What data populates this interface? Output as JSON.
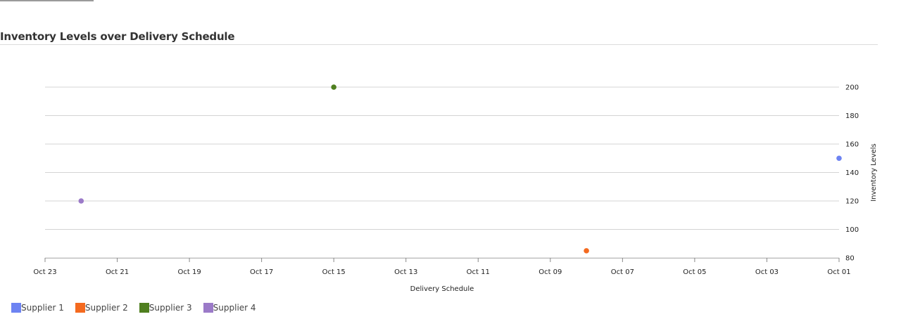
{
  "chart_data": {
    "type": "scatter",
    "title": "Inventory Levels over Delivery Schedule",
    "xlabel": "Delivery Schedule",
    "ylabel": "Inventory Levels",
    "x_axis": {
      "kind": "date",
      "reversed": true,
      "range": [
        "Oct 01",
        "Oct 23"
      ],
      "ticks": [
        "Oct 23",
        "Oct 21",
        "Oct 19",
        "Oct 17",
        "Oct 15",
        "Oct 13",
        "Oct 11",
        "Oct 09",
        "Oct 07",
        "Oct 05",
        "Oct 03",
        "Oct 01"
      ]
    },
    "y_axis": {
      "position": "right",
      "ylim": [
        80,
        200
      ],
      "ticks": [
        80,
        100,
        120,
        140,
        160,
        180,
        200
      ]
    },
    "grid": "horizontal",
    "legend_position": "bottom-left",
    "series": [
      {
        "name": "Supplier 1",
        "color": "#6d83f2",
        "points": [
          {
            "x": "Oct 01",
            "y": 150
          }
        ]
      },
      {
        "name": "Supplier 2",
        "color": "#f46a1f",
        "points": [
          {
            "x": "Oct 08",
            "y": 85
          }
        ]
      },
      {
        "name": "Supplier 3",
        "color": "#4f7f1f",
        "points": [
          {
            "x": "Oct 15",
            "y": 200
          }
        ]
      },
      {
        "name": "Supplier 4",
        "color": "#9b7ac8",
        "points": [
          {
            "x": "Oct 22",
            "y": 120
          }
        ]
      }
    ]
  }
}
